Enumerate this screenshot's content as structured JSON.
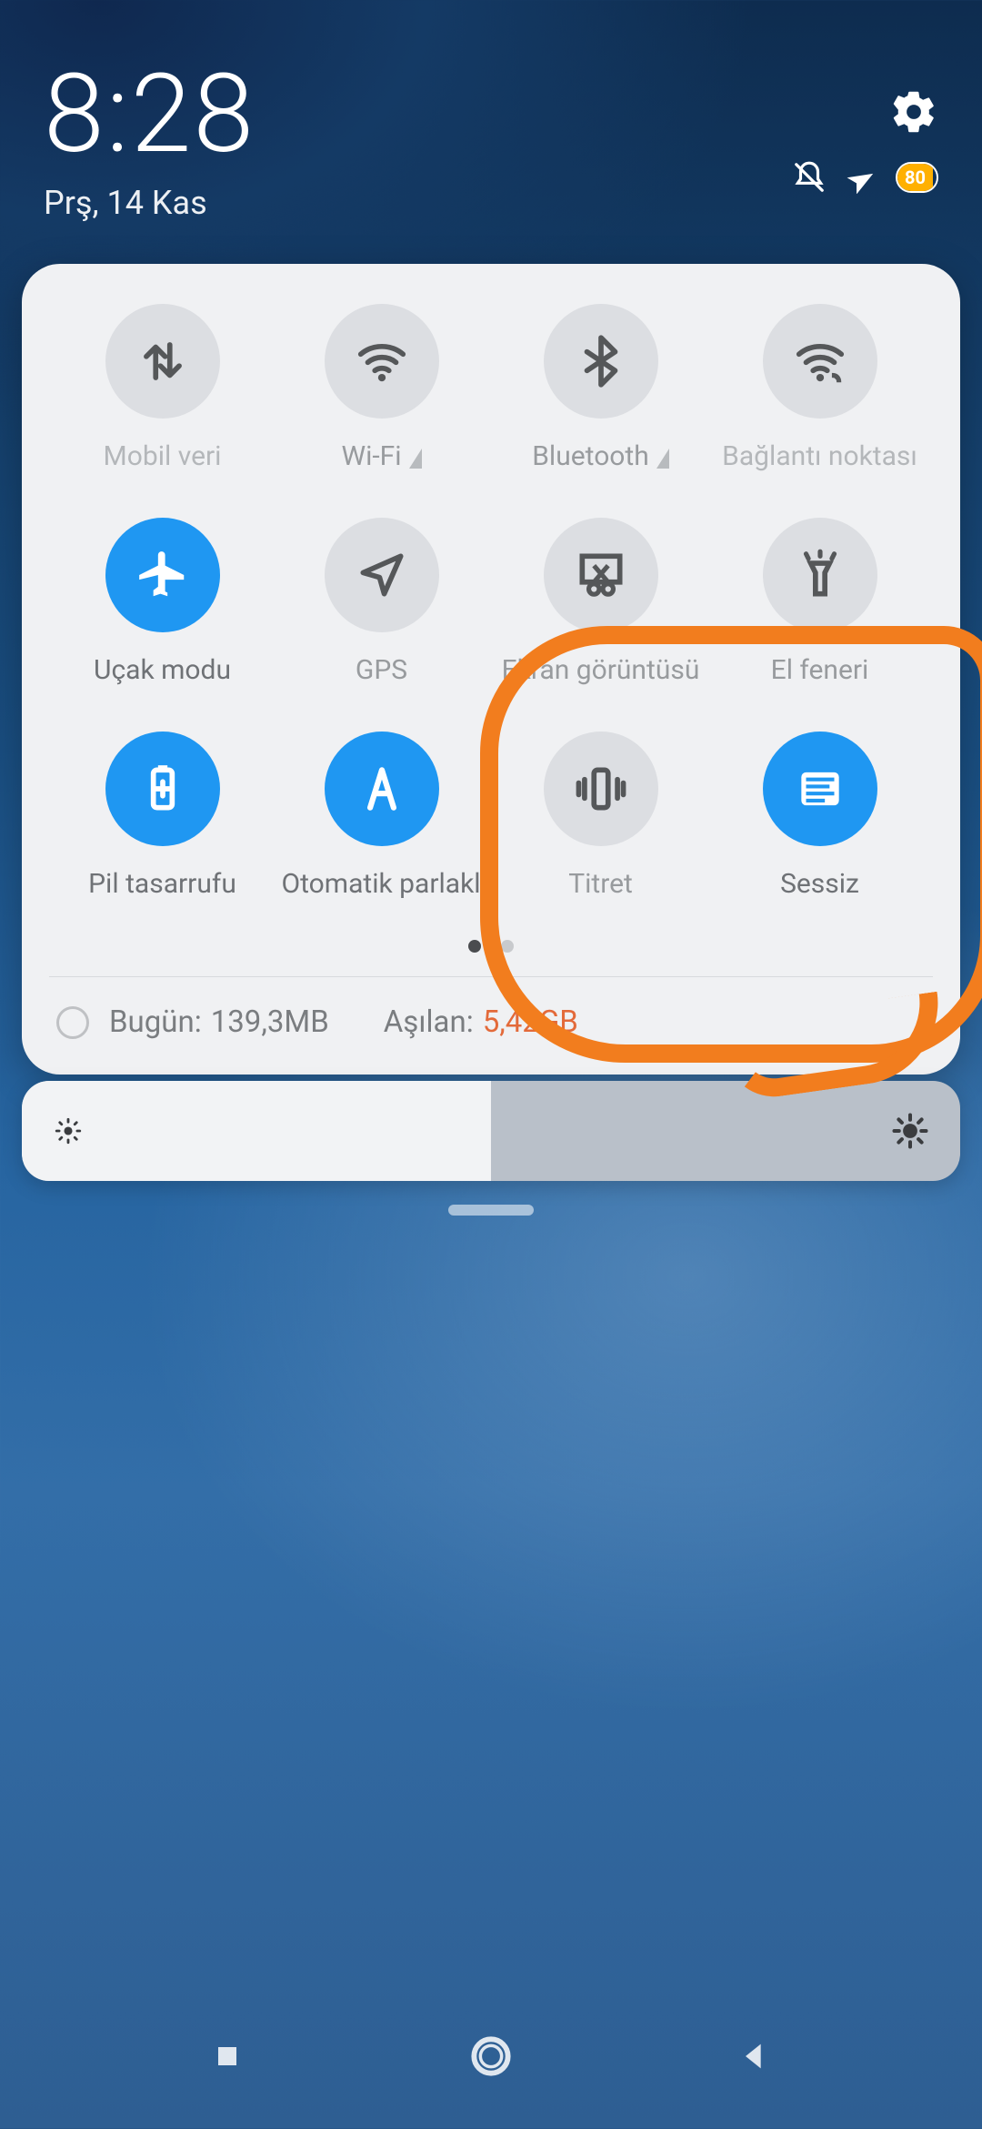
{
  "status": {
    "time": "8:28",
    "date": "Prş, 14 Kas",
    "battery_percent": "80",
    "dnd_on": true,
    "airplane_on": true
  },
  "toggles": [
    {
      "id": "mobile-data",
      "label": "Mobil veri",
      "icon": "data-arrows-icon",
      "state": "disabled",
      "expandable": false
    },
    {
      "id": "wifi",
      "label": "Wi-Fi",
      "icon": "wifi-icon",
      "state": "off",
      "expandable": true
    },
    {
      "id": "bluetooth",
      "label": "Bluetooth",
      "icon": "bluetooth-icon",
      "state": "off",
      "expandable": true
    },
    {
      "id": "hotspot",
      "label": "Bağlantı noktası",
      "icon": "hotspot-icon",
      "state": "disabled",
      "expandable": false
    },
    {
      "id": "airplane",
      "label": "Uçak modu",
      "icon": "airplane-icon",
      "state": "on",
      "expandable": false
    },
    {
      "id": "gps",
      "label": "GPS",
      "icon": "location-icon",
      "state": "off",
      "expandable": false
    },
    {
      "id": "screenshot",
      "label": "Ekran görüntüsü",
      "icon": "screenshot-icon",
      "state": "off",
      "expandable": false
    },
    {
      "id": "flashlight",
      "label": "El feneri",
      "icon": "flashlight-icon",
      "state": "off",
      "expandable": false
    },
    {
      "id": "battery-saver",
      "label": "Pil tasarrufu",
      "icon": "battery-saver-icon",
      "state": "on",
      "expandable": false
    },
    {
      "id": "auto-bright",
      "label": "Otomatik parlaklık",
      "icon": "auto-brightness-icon",
      "state": "on",
      "expandable": false
    },
    {
      "id": "vibrate",
      "label": "Titret",
      "icon": "vibrate-icon",
      "state": "off",
      "expandable": false
    },
    {
      "id": "silent",
      "label": "Sessiz",
      "icon": "silent-icon",
      "state": "on",
      "expandable": false
    }
  ],
  "pager": {
    "total": 2,
    "active": 0
  },
  "data_usage": {
    "today_label": "Bugün:",
    "today_value": "139,3MB",
    "exceeded_label": "Aşılan:",
    "exceeded_value": "5,42GB"
  },
  "brightness": {
    "percent": 50
  },
  "colors": {
    "accent": "#1f97f2",
    "annotation": "#f27d1e",
    "battery": "#ffb000",
    "warn": "#e36a3a"
  }
}
